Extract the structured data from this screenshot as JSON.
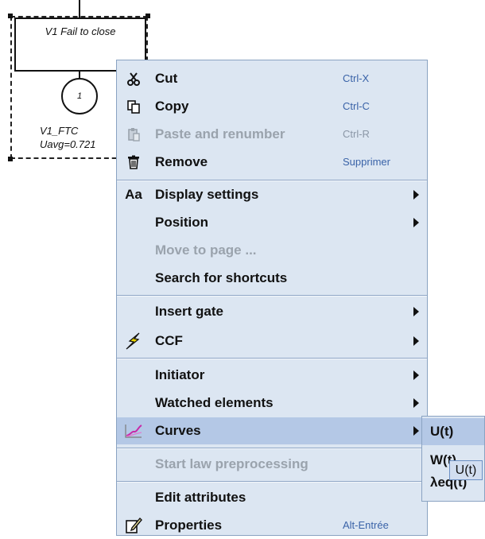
{
  "diagram": {
    "gate_label": "V1 Fail to close",
    "event_number": "1",
    "event_name": "V1_FTC",
    "event_value": "Uavg=0.721"
  },
  "context_menu": {
    "items": [
      {
        "label": "Cut",
        "shortcut": "Ctrl-X",
        "icon": "scissors-icon",
        "enabled": true
      },
      {
        "label": "Copy",
        "shortcut": "Ctrl-C",
        "icon": "copy-icon",
        "enabled": true
      },
      {
        "label": "Paste and renumber",
        "shortcut": "Ctrl-R",
        "icon": "paste-icon",
        "enabled": false
      },
      {
        "label": "Remove",
        "shortcut": "Supprimer",
        "icon": "trash-icon",
        "enabled": true
      },
      {
        "label": "Display settings",
        "icon": "font-aa-icon",
        "icon_text": "Aa",
        "submenu": true,
        "enabled": true
      },
      {
        "label": "Position",
        "submenu": true,
        "enabled": true
      },
      {
        "label": "Move to page ...",
        "enabled": false
      },
      {
        "label": "Search for shortcuts",
        "enabled": true
      },
      {
        "label": "Insert gate",
        "submenu": true,
        "enabled": true
      },
      {
        "label": "CCF",
        "icon": "lightning-icon",
        "submenu": true,
        "enabled": true
      },
      {
        "label": "Initiator",
        "submenu": true,
        "enabled": true
      },
      {
        "label": "Watched elements",
        "submenu": true,
        "enabled": true
      },
      {
        "label": "Curves",
        "icon": "curve-chart-icon",
        "submenu": true,
        "highlighted": true,
        "enabled": true
      },
      {
        "label": "Start law preprocessing",
        "enabled": false
      },
      {
        "label": "Edit attributes",
        "enabled": true
      },
      {
        "label": "Properties",
        "shortcut": "Alt-Entrée",
        "icon": "properties-icon",
        "enabled": true
      }
    ]
  },
  "curves_submenu": {
    "items": [
      {
        "label": "U(t)",
        "highlighted": true
      },
      {
        "label": "W(t)"
      },
      {
        "label": "λeq(t)"
      }
    ]
  },
  "tooltip": {
    "text": "U(t)"
  },
  "colors": {
    "menu_bg": "#dce6f2",
    "highlight_bg": "#b4c8e6",
    "shortcut_text": "#3a63a8",
    "disabled_text": "#9aa3ad"
  }
}
